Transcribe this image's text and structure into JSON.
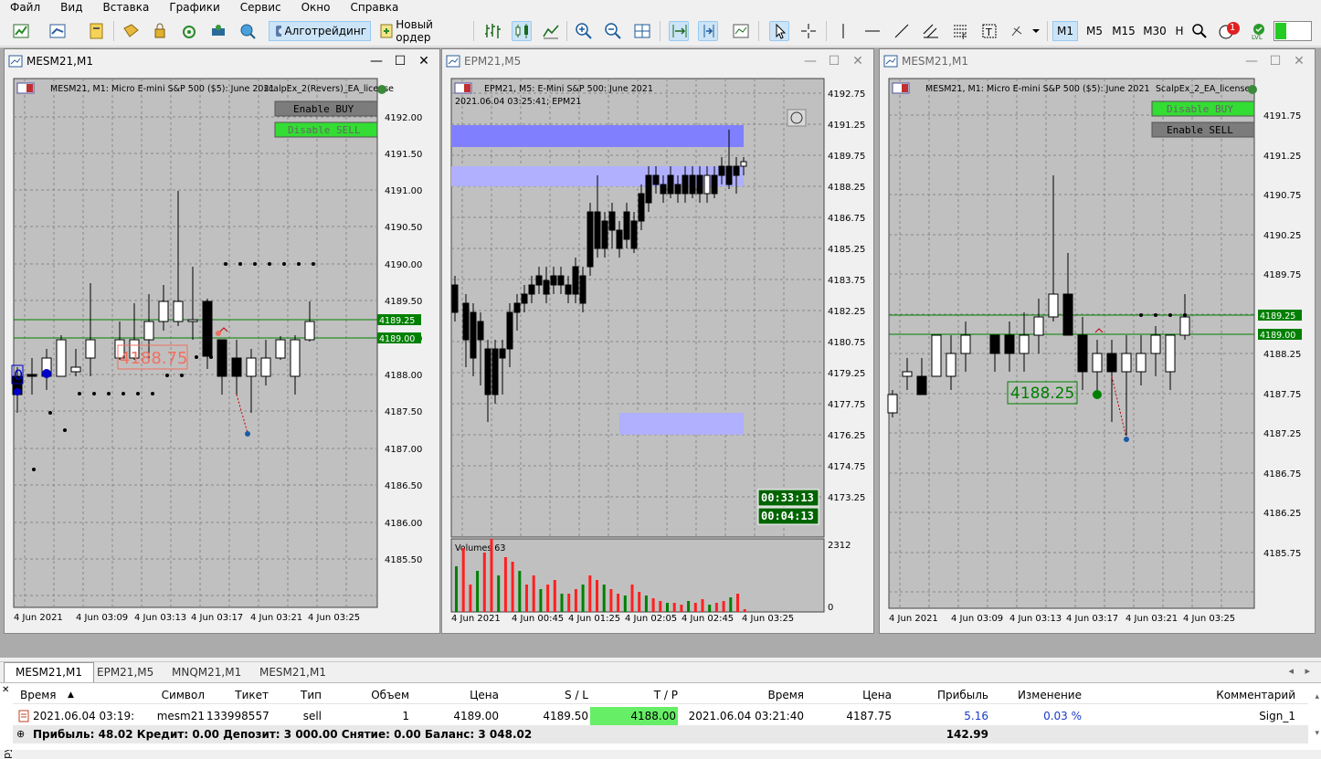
{
  "menu": [
    "Файл",
    "Вид",
    "Вставка",
    "Графики",
    "Сервис",
    "Окно",
    "Справка"
  ],
  "toolbar": {
    "algo_label": "Алготрейдинг",
    "new_order_label": "Новый ордер",
    "timeframes": [
      "M1",
      "M5",
      "M15",
      "M30",
      "H"
    ],
    "notif_count": "1",
    "lvl_label": "LVL"
  },
  "windows": [
    {
      "title": "MESM21,M1",
      "info": "MESM21, M1:  Micro E-mini S&P 500 ($5): June 2021",
      "ea": "scalpEx_2(Revers)_EA_license",
      "btn1": "Enable BUY",
      "btn2": "Disable SELL",
      "price_label": "4188.75",
      "left_box": "0",
      "levels": [
        "4192.00",
        "4191.50",
        "4191.00",
        "4190.50",
        "4190.00",
        "4189.50",
        "4189.25",
        "4189.00",
        "4188.50",
        "4188.00",
        "4187.50",
        "4187.00",
        "4186.50",
        "4186.00",
        "4185.50"
      ],
      "times": [
        "4 Jun 2021",
        "4 Jun 03:09",
        "4 Jun 03:13",
        "4 Jun 03:17",
        "4 Jun 03:21",
        "4 Jun 03:25"
      ]
    },
    {
      "title": "EPM21,M5",
      "info": "EPM21, M5:  E-Mini S&P 500: June 2021",
      "sub": "2021.06.04 03:25:41; EPM21",
      "timer1": "00:33:13",
      "timer2": "00:04:13",
      "volumes_label": "Volumes 63",
      "vol_max": "2312",
      "vol_min": "0",
      "levels": [
        "4192.75",
        "4191.25",
        "4189.75",
        "4188.25",
        "4186.75",
        "4185.25",
        "4183.75",
        "4182.25",
        "4180.75",
        "4179.25",
        "4177.75",
        "4176.25",
        "4174.75",
        "4173.25"
      ],
      "times": [
        "4 Jun 2021",
        "4 Jun 00:45",
        "4 Jun 01:25",
        "4 Jun 02:05",
        "4 Jun 02:45",
        "4 Jun 03:25"
      ]
    },
    {
      "title": "MESM21,M1",
      "info": "MESM21, M1:  Micro E-mini S&P 500 ($5): June 2021",
      "ea": "ScalpEx_2_EA_license",
      "btn1": "Disable BUY",
      "btn2": "Enable SELL",
      "price_label": "4188.25",
      "levels": [
        "4191.75",
        "4191.25",
        "4190.75",
        "4190.25",
        "4189.75",
        "4189.25",
        "4189.00",
        "4188.75",
        "4188.25",
        "4187.75",
        "4187.25",
        "4186.75",
        "4186.25",
        "4185.75"
      ],
      "times": [
        "4 Jun 2021",
        "4 Jun 03:09",
        "4 Jun 03:13",
        "4 Jun 03:17",
        "4 Jun 03:21",
        "4 Jun 03:25"
      ]
    }
  ],
  "tabs": [
    "MESM21,M1",
    "EPM21,M5",
    "MNQM21,M1",
    "MESM21,M1"
  ],
  "terminal": {
    "side_label": "рументы",
    "headers": [
      "Время",
      "Символ",
      "Тикет",
      "Тип",
      "Объем",
      "Цена",
      "S / L",
      "T / P",
      "Время",
      "Цена",
      "Прибыль",
      "Изменение",
      "Комментарий"
    ],
    "row": [
      "2021.06.04 03:19:00",
      "mesm21",
      "133998557",
      "sell",
      "1",
      "4189.00",
      "4189.50",
      "4188.00",
      "2021.06.04 03:21:40",
      "4187.75",
      "5.16",
      "0.03 %",
      "Sign_1"
    ],
    "footer": "Прибыль: 48.02  Кредит: 0.00  Депозит: 3 000.00  Снятие: 0.00  Баланс: 3 048.02",
    "footer_total": "142.99"
  },
  "colors": {
    "chart_bg": "#c0c0c0",
    "grid": "#808080",
    "buy_green": "#33cc33",
    "level_green": "#008000",
    "zone_blue": "#8080ff",
    "tp_green": "#66ee66"
  }
}
